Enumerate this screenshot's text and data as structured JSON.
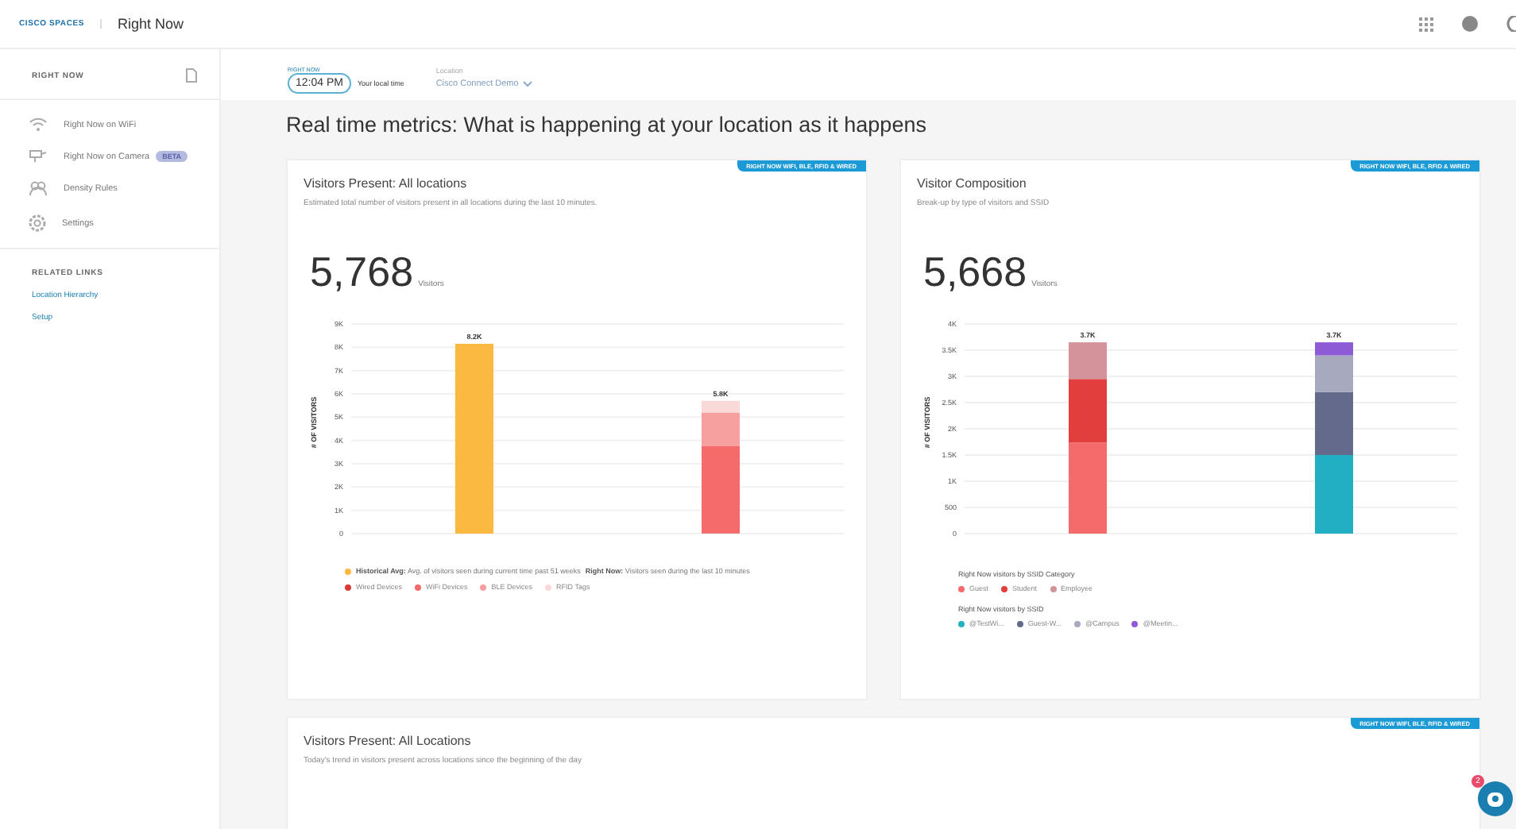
{
  "header": {
    "brand": "CISCO SPACES",
    "title": "Right Now"
  },
  "sidebar": {
    "section": "RIGHT NOW",
    "items": [
      {
        "label": "Right Now on WiFi",
        "selected": false
      },
      {
        "label": "Right Now on Camera",
        "badge": "BETA",
        "selected": false
      },
      {
        "label": "Density Rules",
        "selected": false
      },
      {
        "label": "Settings",
        "selected": false
      }
    ],
    "related_title": "RELATED LINKS",
    "links": [
      "Location Hierarchy",
      "Setup"
    ]
  },
  "toolbar": {
    "live_label": "RIGHT NOW",
    "time": "12:04 PM",
    "time_caption": "Your local time",
    "location_label": "Location",
    "location_value": "Cisco Connect Demo"
  },
  "heading": "Real time metrics: What is happening at your location as it happens",
  "cards": [
    {
      "title": "Visitors Present: All locations",
      "subtitle": "Estimated total number of visitors present in all locations during the last 10 minutes.",
      "tag": "RIGHT NOW WIFI, BLE, RFID & WIRED",
      "total": "5,768",
      "unit": "Visitors",
      "chart_data": {
        "type": "bar",
        "stacked": true,
        "grid": true,
        "ylabel": "# OF VISITORS",
        "ylim": [
          0,
          9000
        ],
        "yticks": [
          {
            "value": 0,
            "label": "0"
          },
          {
            "value": 1000,
            "label": "1K"
          },
          {
            "value": 2000,
            "label": "2K"
          },
          {
            "value": 3000,
            "label": "3K"
          },
          {
            "value": 4000,
            "label": "4K"
          },
          {
            "value": 5000,
            "label": "5K"
          },
          {
            "value": 6000,
            "label": "6K"
          },
          {
            "value": 7000,
            "label": "7K"
          },
          {
            "value": 8000,
            "label": "8K"
          },
          {
            "value": 9000,
            "label": "9K"
          }
        ],
        "value_labels": [
          "8.2K",
          "5.8K"
        ],
        "series": [
          {
            "name": "Historical Avg:",
            "color": "#fbb941",
            "values": [
              8150,
              null
            ]
          },
          {
            "name": "Wired Devices",
            "color": "#d93b3b",
            "values": [
              null,
              20
            ]
          },
          {
            "name": "WiFi Devices",
            "color": "#f56b6b",
            "values": [
              null,
              3730
            ]
          },
          {
            "name": "BLE Devices",
            "color": "#f7a0a0",
            "values": [
              null,
              1450
            ]
          },
          {
            "name": "RFID Tags",
            "color": "#fbd9d9",
            "values": [
              null,
              500
            ]
          }
        ]
      },
      "notes": [
        {
          "text": "Avg. of visitors seen during current time past 51 weeks"
        },
        {
          "lead": "Right Now:",
          "text": "Visitors seen during the last 10 minutes"
        }
      ]
    },
    {
      "title": "Visitor Composition",
      "subtitle": "Break-up by type of visitors and SSID",
      "tag": "RIGHT NOW WIFI, BLE, RFID & WIRED",
      "total": "5,668",
      "unit": "Visitors",
      "chart_data": {
        "type": "bar",
        "stacked": true,
        "grid": true,
        "ylabel": "# OF VISITORS",
        "ylim": [
          0,
          4000
        ],
        "yticks": [
          {
            "value": 0,
            "label": "0"
          },
          {
            "value": 500,
            "label": "500"
          },
          {
            "value": 1000,
            "label": "1K"
          },
          {
            "value": 1500,
            "label": "1.5K"
          },
          {
            "value": 2000,
            "label": "2K"
          },
          {
            "value": 2500,
            "label": "2.5K"
          },
          {
            "value": 3000,
            "label": "3K"
          },
          {
            "value": 3500,
            "label": "3.5K"
          },
          {
            "value": 4000,
            "label": "4K"
          }
        ],
        "value_labels": [
          "3.7K",
          "3.7K"
        ],
        "series": [
          {
            "name": "Guest",
            "color": "#f56b6b",
            "values": [
              1740,
              null
            ]
          },
          {
            "name": "Student",
            "color": "#e23e3e",
            "values": [
              1210,
              null
            ]
          },
          {
            "name": "Employee",
            "color": "#d4939a",
            "values": [
              700,
              null
            ]
          },
          {
            "name": "@TestWi...",
            "color": "#22afc4",
            "values": [
              null,
              1500
            ]
          },
          {
            "name": "Guest-W...",
            "color": "#646a8c",
            "values": [
              null,
              1200
            ]
          },
          {
            "name": "@Campus",
            "color": "#a7a9bf",
            "values": [
              null,
              700
            ]
          },
          {
            "name": "@Meetin...",
            "color": "#8e5bd6",
            "values": [
              null,
              250
            ]
          }
        ]
      },
      "legend_titles": [
        "Right Now visitors by SSID Category",
        "Right Now visitors by SSID"
      ]
    }
  ],
  "trend_card": {
    "title": "Visitors Present: All Locations",
    "subtitle": "Today's trend in visitors present across locations since the beginning of the day",
    "tag": "RIGHT NOW WIFI, BLE, RFID & WIRED"
  },
  "chat": {
    "count": "2"
  }
}
